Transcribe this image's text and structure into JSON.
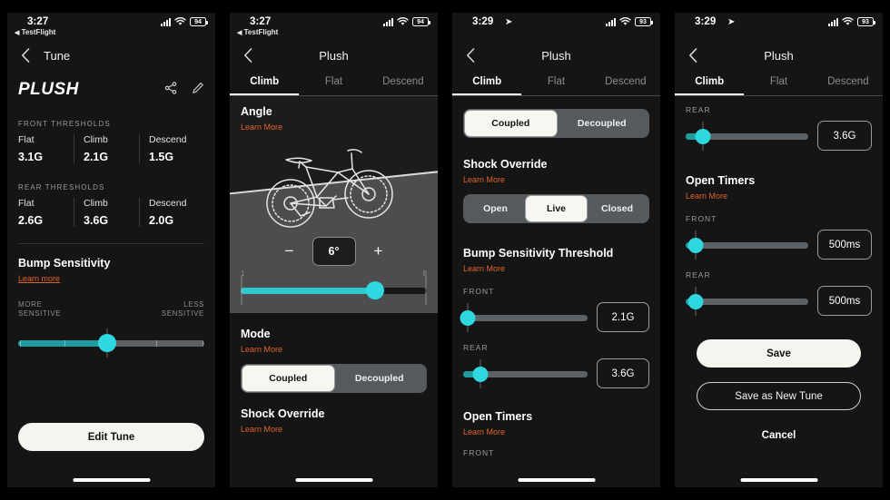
{
  "panels": [
    {
      "id": "tune-detail",
      "status": {
        "time": "3:27",
        "carrier_note": "TestFlight",
        "battery": "94",
        "has_location_arrow": false
      },
      "nav": {
        "back_icon": "chevron-left-icon",
        "title": "Tune",
        "title_position": "inline"
      },
      "brand": "PLUSH",
      "actions": [
        {
          "name": "share-icon",
          "label": "Share"
        },
        {
          "name": "pencil-icon",
          "label": "Edit"
        }
      ],
      "front_thresholds_label": "FRONT THRESHOLDS",
      "front_thresholds": [
        {
          "name": "Flat",
          "value": "3.1G"
        },
        {
          "name": "Climb",
          "value": "2.1G"
        },
        {
          "name": "Descend",
          "value": "1.5G"
        }
      ],
      "rear_thresholds_label": "REAR THRESHOLDS",
      "rear_thresholds": [
        {
          "name": "Flat",
          "value": "2.6G"
        },
        {
          "name": "Climb",
          "value": "3.6G"
        },
        {
          "name": "Descend",
          "value": "2.0G"
        }
      ],
      "bump": {
        "title": "Bump Sensitivity",
        "learn": "Learn more",
        "left_label_line1": "MORE",
        "left_label_line2": "SENSITIVE",
        "right_label_line1": "LESS",
        "right_label_line2": "SENSITIVE",
        "slider_percent": 48
      },
      "edit_button": "Edit Tune"
    },
    {
      "id": "tune-edit-angle",
      "status": {
        "time": "3:27",
        "carrier_note": "TestFlight",
        "battery": "94",
        "has_location_arrow": false
      },
      "nav": {
        "back_icon": "chevron-left-icon",
        "title": "Plush",
        "title_position": "center"
      },
      "tabs": [
        {
          "label": "Climb",
          "active": true
        },
        {
          "label": "Flat",
          "active": false
        },
        {
          "label": "Descend",
          "active": false
        }
      ],
      "angle": {
        "title": "Angle",
        "learn": "Learn More",
        "value": "6°",
        "minus": "−",
        "plus": "+",
        "scale_min": "1",
        "scale_max": "8",
        "slider_percent": 72
      },
      "mode": {
        "title": "Mode",
        "learn": "Learn More",
        "options": [
          {
            "label": "Coupled",
            "selected": true
          },
          {
            "label": "Decoupled",
            "selected": false
          }
        ]
      },
      "shock_override": {
        "title": "Shock Override",
        "learn": "Learn More"
      }
    },
    {
      "id": "tune-edit-shock",
      "status": {
        "time": "3:29",
        "carrier_note": "",
        "battery": "93",
        "has_location_arrow": true
      },
      "nav": {
        "back_icon": "chevron-left-icon",
        "title": "Plush",
        "title_position": "center"
      },
      "tabs": [
        {
          "label": "Climb",
          "active": true
        },
        {
          "label": "Flat",
          "active": false
        },
        {
          "label": "Descend",
          "active": false
        }
      ],
      "mode": {
        "options": [
          {
            "label": "Coupled",
            "selected": true
          },
          {
            "label": "Decoupled",
            "selected": false
          }
        ]
      },
      "shock_override": {
        "title": "Shock Override",
        "learn": "Learn More",
        "options": [
          {
            "label": "Open",
            "selected": false
          },
          {
            "label": "Live",
            "selected": true
          },
          {
            "label": "Closed",
            "selected": false
          }
        ]
      },
      "bump_threshold": {
        "title": "Bump Sensitivity Threshold",
        "learn": "Learn More",
        "rows": [
          {
            "label": "FRONT",
            "value": "2.1G",
            "slider_percent": 2
          },
          {
            "label": "REAR",
            "value": "3.6G",
            "slider_percent": 12
          }
        ]
      },
      "open_timers": {
        "title": "Open Timers",
        "learn": "Learn More",
        "first_row_label": "FRONT"
      }
    },
    {
      "id": "tune-edit-timers",
      "status": {
        "time": "3:29",
        "carrier_note": "",
        "battery": "93",
        "has_location_arrow": true
      },
      "nav": {
        "back_icon": "chevron-left-icon",
        "title": "Plush",
        "title_position": "center"
      },
      "tabs": [
        {
          "label": "Climb",
          "active": true
        },
        {
          "label": "Flat",
          "active": false
        },
        {
          "label": "Descend",
          "active": false
        }
      ],
      "top_row": {
        "label": "REAR",
        "value": "3.6G",
        "slider_percent": 12
      },
      "open_timers": {
        "title": "Open Timers",
        "learn": "Learn More",
        "rows": [
          {
            "label": "FRONT",
            "value": "500ms",
            "slider_percent": 6
          },
          {
            "label": "REAR",
            "value": "500ms",
            "slider_percent": 6
          }
        ]
      },
      "buttons": {
        "save": "Save",
        "save_as_new": "Save as New Tune",
        "cancel": "Cancel"
      }
    }
  ],
  "colors": {
    "accent_teal": "#2ed8de",
    "accent_teal_dark": "#1f9ca0",
    "learn_orange": "#e0632a",
    "screen_bg": "#151515",
    "panel_bg": "#1c1c1c",
    "track_gray": "#5c6165"
  }
}
